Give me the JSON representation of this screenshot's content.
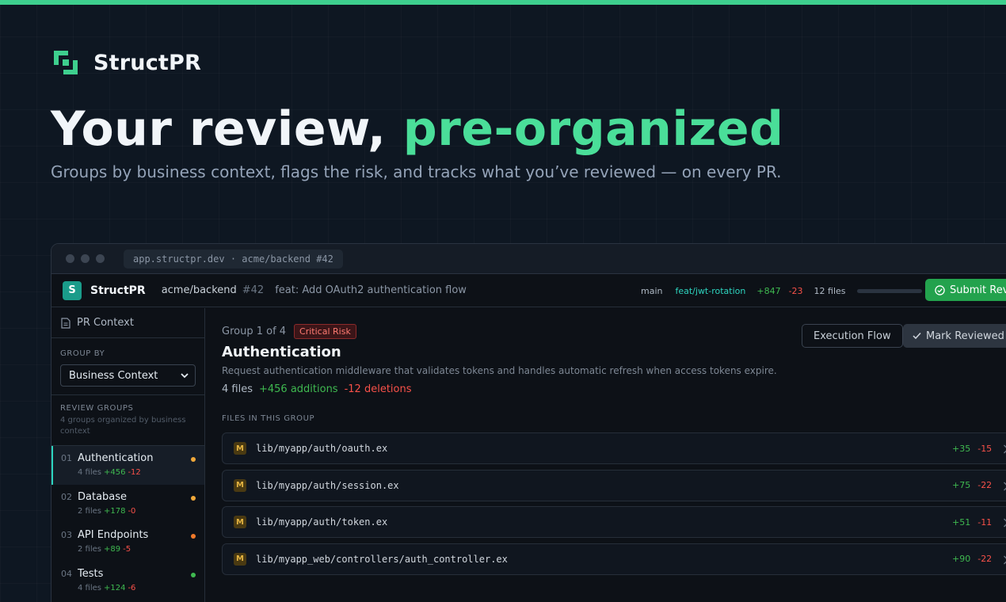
{
  "hero": {
    "brand": "StructPR",
    "headline_main": "Your review, ",
    "headline_accent": "pre-organized",
    "subline": "Groups by business context, flags the risk, and tracks what you’ve reviewed — on every PR."
  },
  "browser": {
    "url": "app.structpr.dev · acme/backend #42"
  },
  "appbar": {
    "badge": "S",
    "app_name": "StructPR",
    "repo": "acme/backend",
    "pr_number": "#42",
    "pr_title": "feat: Add OAuth2 authentication flow",
    "base_branch": "main",
    "head_branch": "feat/jwt-rotation",
    "additions": "+847",
    "deletions": "-23",
    "files": "12 files",
    "review_progress": 0,
    "submit_label": "Submit Review"
  },
  "sidebar": {
    "context_label": "PR Context",
    "group_by_label": "GROUP BY",
    "group_by_value": "Business Context",
    "review_groups_label": "REVIEW GROUPS",
    "review_groups_desc": "4 groups organized by business context",
    "groups": [
      {
        "num": "01",
        "name": "Authentication",
        "files": "4 files",
        "add": "+456",
        "del": "-12",
        "status_color": "#f0a83a"
      },
      {
        "num": "02",
        "name": "Database",
        "files": "2 files",
        "add": "+178",
        "del": "-0",
        "status_color": "#f0a83a"
      },
      {
        "num": "03",
        "name": "API Endpoints",
        "files": "2 files",
        "add": "+89",
        "del": "-5",
        "status_color": "#f07a2a"
      },
      {
        "num": "04",
        "name": "Tests",
        "files": "4 files",
        "add": "+124",
        "del": "-6",
        "status_color": "#3fb950"
      }
    ]
  },
  "main": {
    "group_counter": "Group 1 of 4",
    "risk_label": "Critical Risk",
    "title": "Authentication",
    "description": "Request authentication middleware that validates tokens and handles automatic refresh when access tokens expire.",
    "files_count": "4 files",
    "additions": "+456 additions",
    "deletions": "-12 deletions",
    "execution_flow_label": "Execution Flow",
    "mark_reviewed_label": "Mark Reviewed",
    "files_heading": "FILES IN THIS GROUP",
    "files": [
      {
        "badge": "M",
        "path": "lib/myapp/auth/oauth.ex",
        "add": "+35",
        "del": "-15"
      },
      {
        "badge": "M",
        "path": "lib/myapp/auth/session.ex",
        "add": "+75",
        "del": "-22"
      },
      {
        "badge": "M",
        "path": "lib/myapp/auth/token.ex",
        "add": "+51",
        "del": "-11"
      },
      {
        "badge": "M",
        "path": "lib/myapp_web/controllers/auth_controller.ex",
        "add": "+90",
        "del": "-22"
      }
    ]
  },
  "colors": {
    "accent": "#4ade99",
    "teal": "#2dd4bf",
    "add": "#3fb950",
    "del": "#f85149",
    "submit": "#23a24d"
  }
}
